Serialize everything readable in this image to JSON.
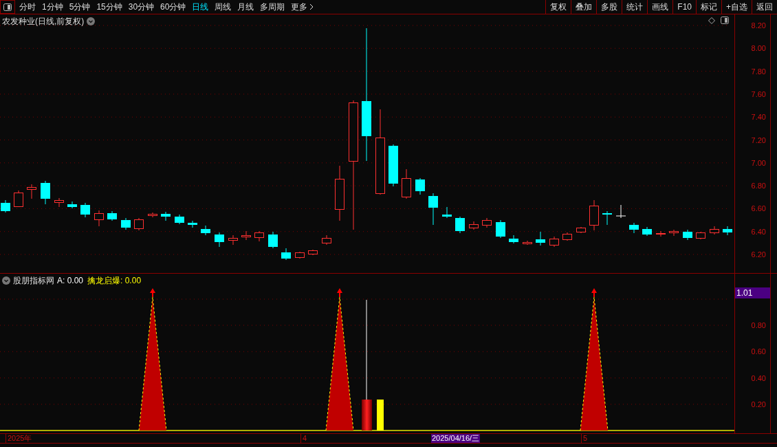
{
  "toolbar": {
    "periods": [
      {
        "label": "分时",
        "selected": false
      },
      {
        "label": "1分钟",
        "selected": false
      },
      {
        "label": "5分钟",
        "selected": false
      },
      {
        "label": "15分钟",
        "selected": false
      },
      {
        "label": "30分钟",
        "selected": false
      },
      {
        "label": "60分钟",
        "selected": false
      },
      {
        "label": "日线",
        "selected": true
      },
      {
        "label": "周线",
        "selected": false
      },
      {
        "label": "月线",
        "selected": false
      },
      {
        "label": "多周期",
        "selected": false
      }
    ],
    "more": "更多",
    "buttons": [
      "复权",
      "叠加",
      "多股",
      "统计",
      "画线",
      "F10",
      "标记",
      "+自选",
      "返回"
    ]
  },
  "main_chart": {
    "title": "农发种业(日线,前复权)",
    "y_labels": [
      "8.20",
      "8.00",
      "7.80",
      "7.60",
      "7.40",
      "7.20",
      "7.00",
      "6.80",
      "6.60",
      "6.40",
      "6.20"
    ]
  },
  "indicator": {
    "name": "股朋指标网",
    "values": [
      {
        "label": "A:",
        "value": "0.00",
        "color": "#ffffff"
      },
      {
        "label": "擒龙启爆:",
        "value": "0.00",
        "color": "#ffff00"
      }
    ],
    "cursor_value": "1.01",
    "y_labels": [
      "0.80",
      "0.60",
      "0.40",
      "0.20"
    ]
  },
  "x_axis": {
    "labels": [
      {
        "text": "2025年",
        "kind": "date"
      },
      {
        "text": "4",
        "kind": "date"
      },
      {
        "text": "2025/04/16/三",
        "kind": "cursor"
      },
      {
        "text": "5",
        "kind": "date"
      }
    ]
  }
}
